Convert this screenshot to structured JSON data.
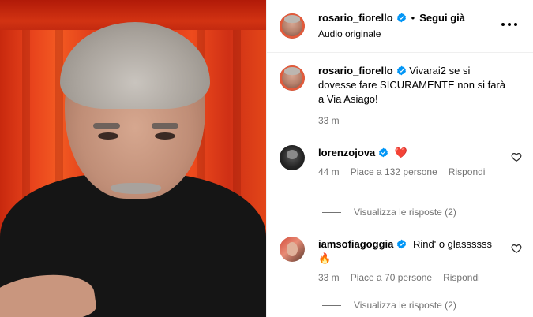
{
  "post": {
    "username": "rosario_fiorello",
    "follow_label": "Segui già",
    "audio_label": "Audio originale",
    "more_icon": "more-horizontal-icon"
  },
  "caption": {
    "username": "rosario_fiorello",
    "text_line1": "Vivarai2 se si",
    "text_line2": "dovesse fare SICURAMENTE non si farà",
    "text_line3": "a Via Asiago!",
    "time": "33 m"
  },
  "comments": [
    {
      "username": "lorenzojova",
      "text": "❤️",
      "time": "44 m",
      "likes": "Piace a 132 persone",
      "reply_label": "Rispondi",
      "view_replies": "Visualizza le risposte (2)"
    },
    {
      "username": "iamsofiagoggia",
      "text": "Rind' o glassssss",
      "emoji": "🔥",
      "time": "33 m",
      "likes": "Piace a 70 persone",
      "reply_label": "Rispondi",
      "view_replies": "Visualizza le risposte (2)"
    }
  ],
  "colors": {
    "verified_blue": "#0095f6",
    "meta_gray": "#737373",
    "heart_red": "#ed1c24"
  }
}
